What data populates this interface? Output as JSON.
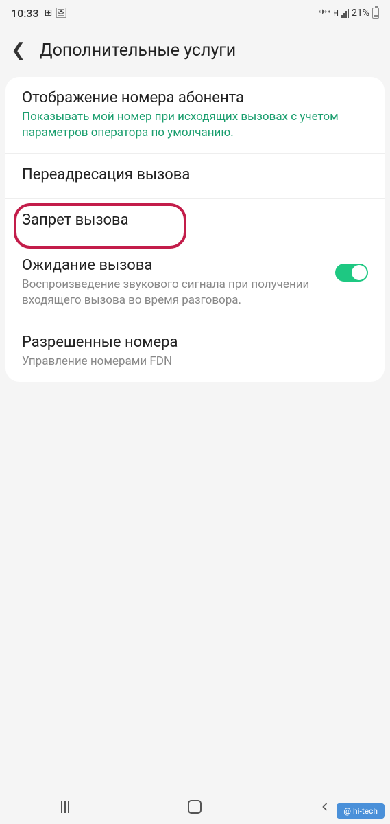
{
  "status": {
    "time": "10:33",
    "network_label": "H",
    "battery_percent": "21%"
  },
  "header": {
    "title": "Дополнительные услуги"
  },
  "settings": {
    "caller_id": {
      "title": "Отображение номера абонента",
      "subtitle": "Показывать мой номер при исходящих вызовах с учетом параметров оператора по умолчанию."
    },
    "call_forwarding": {
      "title": "Переадресация вызова"
    },
    "call_barring": {
      "title": "Запрет вызова"
    },
    "call_waiting": {
      "title": "Ожидание вызова",
      "subtitle": "Воспроизведение звукового сигнала при получении входящего вызова во время разговора."
    },
    "allowed_numbers": {
      "title": "Разрешенные номера",
      "subtitle": "Управление номерами FDN"
    }
  },
  "watermark": "@ hi-tech"
}
